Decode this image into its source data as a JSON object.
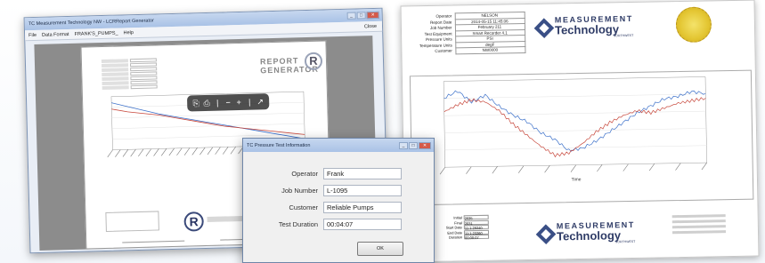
{
  "left_window": {
    "title": "TC Measurement Technology NW - LCRReport Generator",
    "menu": [
      "File",
      "Data Format",
      "FRANK'S_PUMPS_",
      "Help"
    ],
    "close_label": "Close",
    "page": {
      "logo_text": "REPORT GENERATOR",
      "r_mark": "R",
      "footer_mark": "R"
    },
    "viewer_tools": [
      "⎘",
      "⎙",
      "|",
      "−",
      "+",
      "|",
      "↗"
    ]
  },
  "report": {
    "info": [
      {
        "label": "Operator",
        "value": "NELSON"
      },
      {
        "label": "Report Date",
        "value": "2014-05-15 11:45:06"
      },
      {
        "label": "Job Number",
        "value": "February 211"
      },
      {
        "label": "Test Equipment",
        "value": "Smart Recorder 4.1"
      },
      {
        "label": "Pressure Units",
        "value": "PSI"
      },
      {
        "label": "Temperature Units",
        "value": "degF"
      },
      {
        "label": "Customer",
        "value": "NW0000"
      }
    ],
    "logo": {
      "line1": "MEASUREMENT",
      "line2": "Technology",
      "line3": "NORTHWEST"
    },
    "footer_info": [
      {
        "label": "Initial",
        "value": "2035"
      },
      {
        "label": "Final",
        "value": "2031"
      },
      {
        "label": "Start Date",
        "value": "11:1:29240"
      },
      {
        "label": "End Date",
        "value": "11:1:23260"
      },
      {
        "label": "Duration",
        "value": "00:00:07"
      }
    ],
    "footer_logo": {
      "line1": "MEASUREMENT",
      "line2": "Technology",
      "line3": "NORTHWEST"
    }
  },
  "dialog": {
    "title": "TC Pressure Test Information",
    "fields": [
      {
        "label": "Operator",
        "value": "Frank"
      },
      {
        "label": "Job Number",
        "value": "L-1095"
      },
      {
        "label": "Customer",
        "value": "Reliable Pumps"
      },
      {
        "label": "Test Duration",
        "value": "00:04:07"
      }
    ],
    "ok_label": "OK"
  },
  "colors": {
    "pressure_series": "#3a6fc9",
    "temperature_series": "#c7463a",
    "titlebar": "#b6cbea",
    "logo_blue": "#2e3b66",
    "seal_gold": "#e3c531"
  },
  "chart_data": [
    {
      "type": "line",
      "title": "",
      "xlabel": "Time",
      "ylabel": "",
      "series": [
        {
          "values": [
            26.2,
            26.5,
            26.0,
            26.3,
            25.8,
            25.4,
            25.1,
            24.6,
            24.3,
            23.8,
            23.9,
            24.2,
            24.6,
            25.0,
            25.4,
            25.7,
            26.0,
            26.1,
            26.3,
            26.2
          ]
        },
        {
          "values": [
            25.6,
            25.9,
            26.1,
            26.0,
            25.6,
            25.0,
            24.5,
            24.0,
            23.6,
            23.7,
            24.1,
            24.6,
            25.0,
            25.3,
            25.5,
            25.4,
            25.6,
            25.8,
            25.9,
            26.0
          ]
        }
      ],
      "grid": true
    },
    {
      "type": "line",
      "title": "",
      "xlabel": "",
      "ylabel": "",
      "series": [
        {
          "values": [
            0.82,
            0.78,
            0.74,
            0.7,
            0.67,
            0.64,
            0.61,
            0.58,
            0.55,
            0.52,
            0.49,
            0.46,
            0.43
          ]
        },
        {
          "values": [
            0.76,
            0.73,
            0.71,
            0.69,
            0.66,
            0.63,
            0.6,
            0.57,
            0.55,
            0.53,
            0.51,
            0.49,
            0.47
          ]
        }
      ],
      "grid": true
    }
  ]
}
